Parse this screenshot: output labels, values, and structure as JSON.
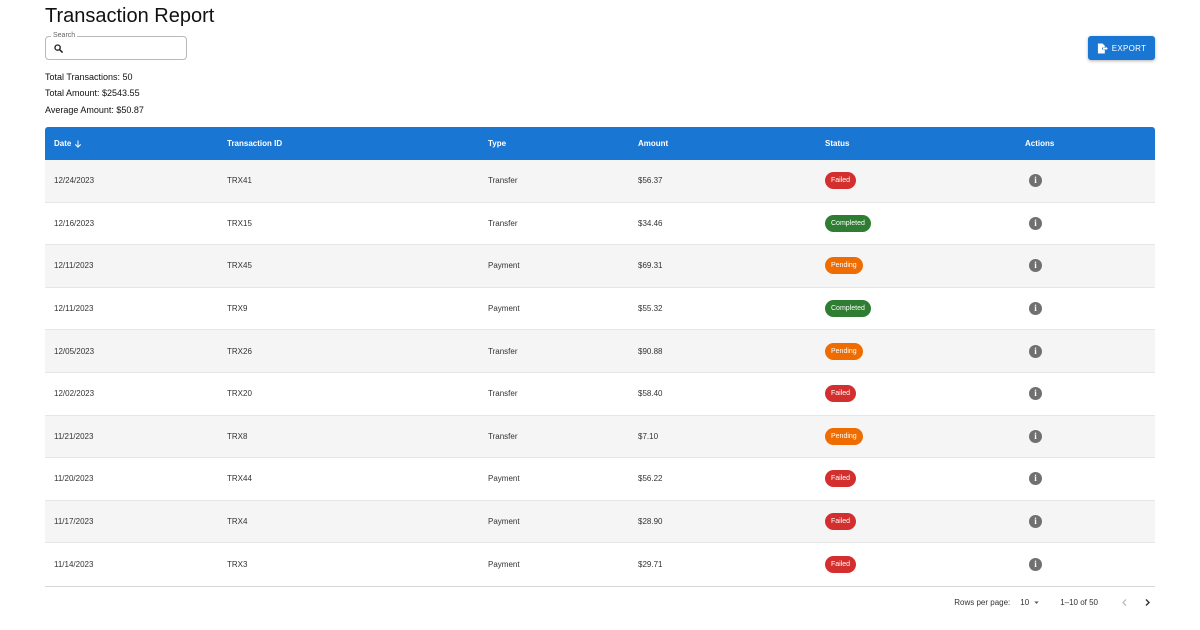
{
  "page": {
    "title": "Transaction Report"
  },
  "search": {
    "label": "Search",
    "value": "",
    "placeholder": ""
  },
  "export": {
    "label": "EXPORT"
  },
  "stats": {
    "total_transactions": "Total Transactions: 50",
    "total_amount": "Total Amount: $2543.55",
    "average_amount": "Average Amount: $50.87"
  },
  "table": {
    "sort_column": "Date",
    "sort_direction": "descending",
    "headers": {
      "date": "Date",
      "transaction_id": "Transaction ID",
      "type": "Type",
      "amount": "Amount",
      "status": "Status",
      "actions": "Actions"
    },
    "rows": [
      {
        "date": "12/24/2023",
        "transaction_id": "TRX41",
        "type": "Transfer",
        "amount": "$56.37",
        "status": "Failed"
      },
      {
        "date": "12/16/2023",
        "transaction_id": "TRX15",
        "type": "Transfer",
        "amount": "$34.46",
        "status": "Completed"
      },
      {
        "date": "12/11/2023",
        "transaction_id": "TRX45",
        "type": "Payment",
        "amount": "$69.31",
        "status": "Pending"
      },
      {
        "date": "12/11/2023",
        "transaction_id": "TRX9",
        "type": "Payment",
        "amount": "$55.32",
        "status": "Completed"
      },
      {
        "date": "12/05/2023",
        "transaction_id": "TRX26",
        "type": "Transfer",
        "amount": "$90.88",
        "status": "Pending"
      },
      {
        "date": "12/02/2023",
        "transaction_id": "TRX20",
        "type": "Transfer",
        "amount": "$58.40",
        "status": "Failed"
      },
      {
        "date": "11/21/2023",
        "transaction_id": "TRX8",
        "type": "Transfer",
        "amount": "$7.10",
        "status": "Pending"
      },
      {
        "date": "11/20/2023",
        "transaction_id": "TRX44",
        "type": "Payment",
        "amount": "$56.22",
        "status": "Failed"
      },
      {
        "date": "11/17/2023",
        "transaction_id": "TRX4",
        "type": "Payment",
        "amount": "$28.90",
        "status": "Failed"
      },
      {
        "date": "11/14/2023",
        "transaction_id": "TRX3",
        "type": "Payment",
        "amount": "$29.71",
        "status": "Failed"
      }
    ]
  },
  "pagination": {
    "rows_per_page_label": "Rows per page:",
    "rows_per_page": "10",
    "range": "1–10 of 50"
  },
  "colors": {
    "primary": "#1976d2",
    "failed": "#d32f2f",
    "completed": "#2e7d32",
    "pending": "#ef6c00",
    "row_alt": "#f5f5f5"
  },
  "icons": {
    "search": "search-icon",
    "export": "export-file-icon",
    "sort": "arrow-down-icon",
    "action": "info-icon",
    "rows_per_page": "caret-down-icon",
    "prev_page": "chevron-left-icon",
    "next_page": "chevron-right-icon"
  }
}
